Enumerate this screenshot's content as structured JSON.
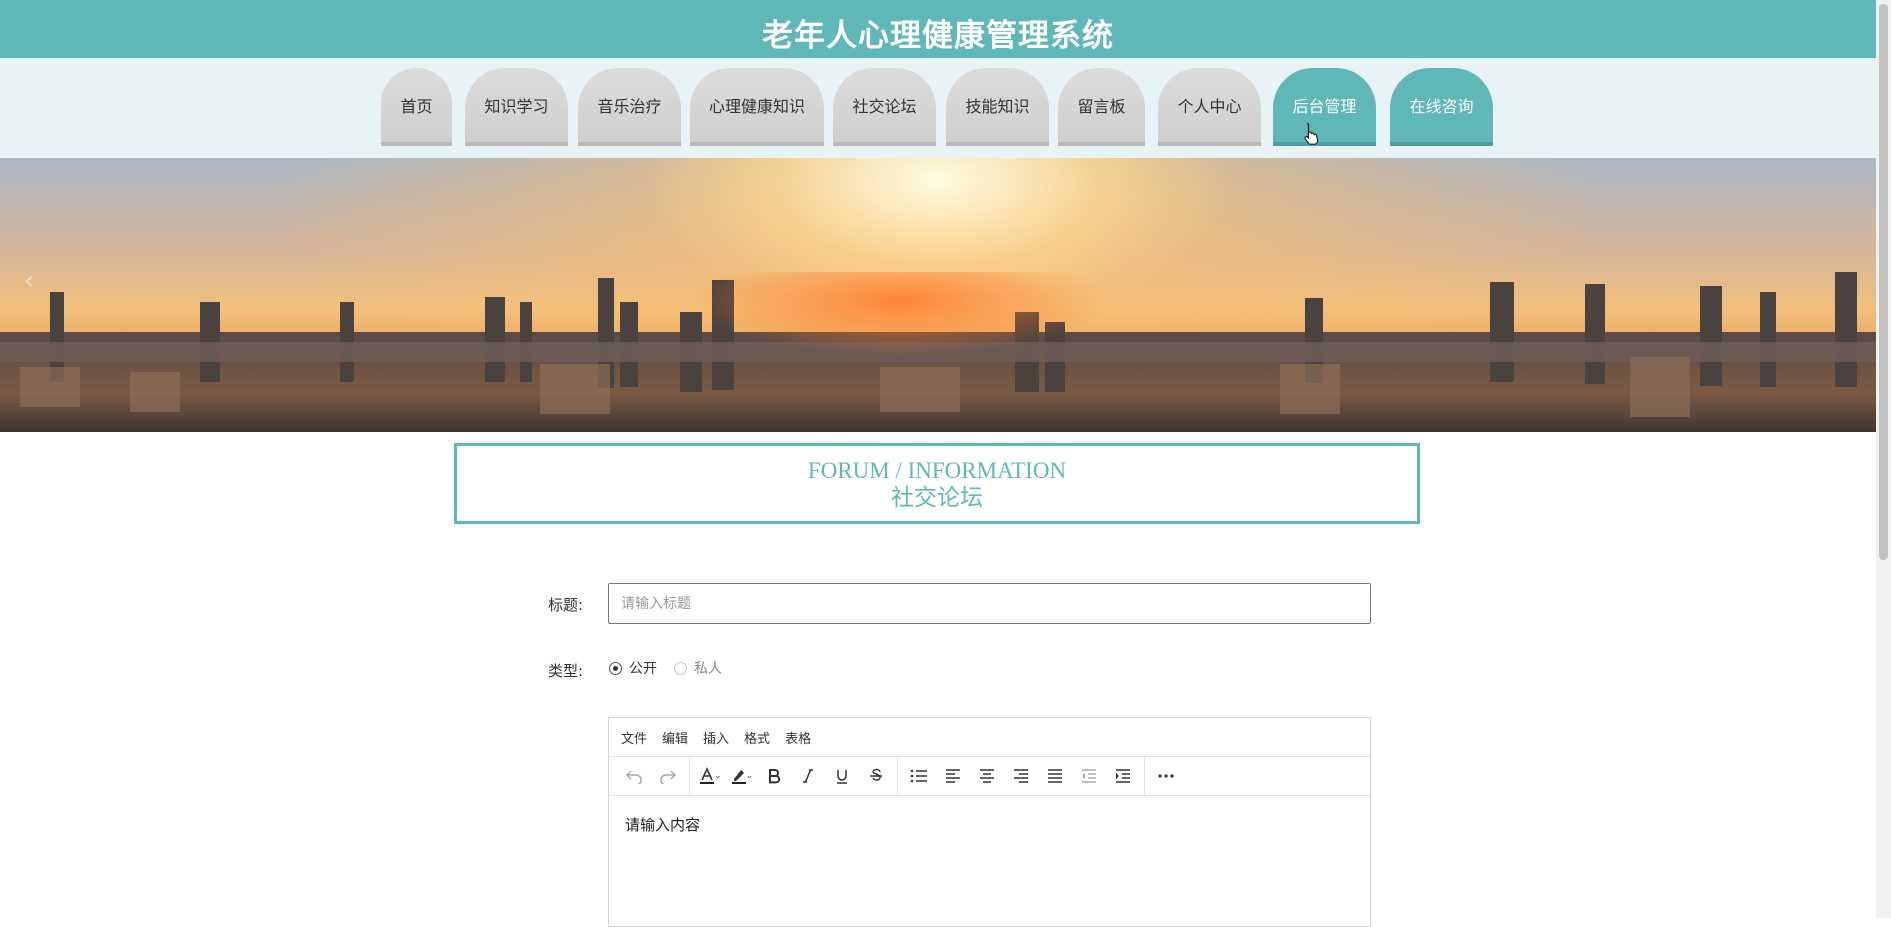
{
  "header": {
    "title": "老年人心理健康管理系统"
  },
  "nav": {
    "items": [
      {
        "label": "首页"
      },
      {
        "label": "知识学习"
      },
      {
        "label": "音乐治疗"
      },
      {
        "label": "心理健康知识"
      },
      {
        "label": "社交论坛"
      },
      {
        "label": "技能知识"
      },
      {
        "label": "留言板"
      },
      {
        "label": "个人中心"
      },
      {
        "label": "后台管理"
      },
      {
        "label": "在线咨询"
      }
    ],
    "active_color": "#60b7b8"
  },
  "banner": {
    "prev_glyph": "‹"
  },
  "section": {
    "title_en": "FORUM / INFORMATION",
    "title_cn": "社交论坛"
  },
  "form": {
    "title_label": "标题:",
    "title_placeholder": "请输入标题",
    "title_value": "",
    "type_label": "类型:",
    "type_options": [
      {
        "label": "公开",
        "selected": true
      },
      {
        "label": "私人",
        "selected": false
      }
    ]
  },
  "editor": {
    "menu": [
      "文件",
      "编辑",
      "插入",
      "格式",
      "表格"
    ],
    "toolbar_icons": [
      "undo-icon",
      "redo-icon",
      "font-color-icon",
      "highlight-icon",
      "bold-icon",
      "italic-icon",
      "underline-icon",
      "strikethrough-icon",
      "bullet-list-icon",
      "align-left-icon",
      "align-center-icon",
      "align-right-icon",
      "justify-icon",
      "outdent-icon",
      "indent-icon",
      "more-icon"
    ],
    "content_placeholder": "请输入内容"
  },
  "colors": {
    "brand": "#60b7b8",
    "nav_inactive": "#d6d6d6",
    "nav_bg": "#e9f2f4"
  }
}
